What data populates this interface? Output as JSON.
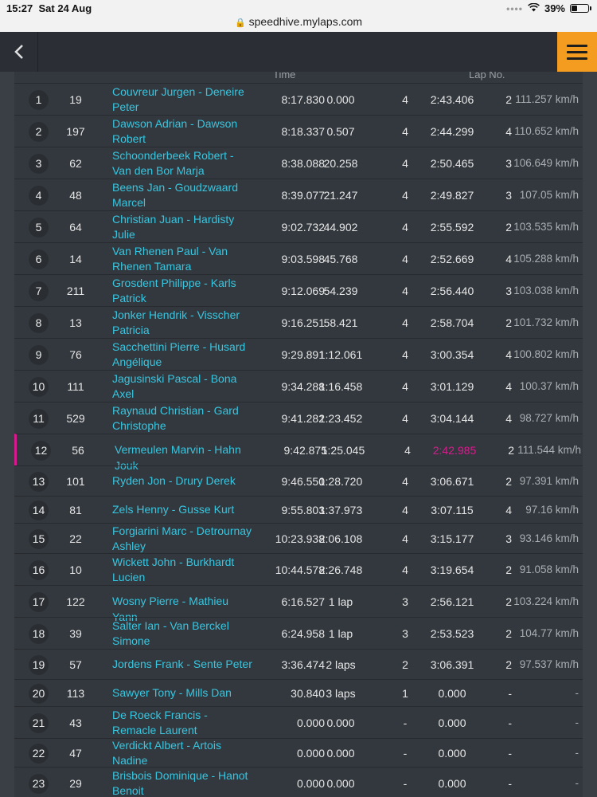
{
  "status_bar": {
    "time": "15:27",
    "date": "Sat 24 Aug",
    "url": "speedhive.mylaps.com",
    "battery": "39%",
    "battery_level": 0.39
  },
  "nav": {
    "back_icon": "chevron-left-icon",
    "menu_icon": "hamburger-menu-icon",
    "menu_color": "#f39c1f"
  },
  "header": {
    "time_label": "Time",
    "lapno_label": "Lap No."
  },
  "colors": {
    "name_link": "#37c6e0",
    "best_lap_highlight": "#d81b8c",
    "background": "#33383e"
  },
  "rows": [
    {
      "pos": "1",
      "num": "19",
      "name": "Couvreur Jurgen - Deneire Peter",
      "time": "8:17.830",
      "gap": "0.000",
      "laps": "4",
      "best": "2:43.406",
      "best_lap": "2",
      "speed": "111.257 km/h"
    },
    {
      "pos": "2",
      "num": "197",
      "name": "Dawson Adrian - Dawson Robert",
      "time": "8:18.337",
      "gap": "0.507",
      "laps": "4",
      "best": "2:44.299",
      "best_lap": "4",
      "speed": "110.652 km/h"
    },
    {
      "pos": "3",
      "num": "62",
      "name": "Schoonderbeek Robert - Van den Bor Marja",
      "time": "8:38.088",
      "gap": "20.258",
      "laps": "4",
      "best": "2:50.465",
      "best_lap": "3",
      "speed": "106.649 km/h"
    },
    {
      "pos": "4",
      "num": "48",
      "name": "Beens Jan - Goudzwaard Marcel",
      "time": "8:39.077",
      "gap": "21.247",
      "laps": "4",
      "best": "2:49.827",
      "best_lap": "3",
      "speed": "107.05 km/h"
    },
    {
      "pos": "5",
      "num": "64",
      "name": "Christian Juan - Hardisty Julie",
      "time": "9:02.732",
      "gap": "44.902",
      "laps": "4",
      "best": "2:55.592",
      "best_lap": "2",
      "speed": "103.535 km/h"
    },
    {
      "pos": "6",
      "num": "14",
      "name": "Van Rhenen Paul - Van Rhenen Tamara",
      "time": "9:03.598",
      "gap": "45.768",
      "laps": "4",
      "best": "2:52.669",
      "best_lap": "4",
      "speed": "105.288 km/h"
    },
    {
      "pos": "7",
      "num": "211",
      "name": "Grosdent Philippe - Karls Patrick",
      "time": "9:12.069",
      "gap": "54.239",
      "laps": "4",
      "best": "2:56.440",
      "best_lap": "3",
      "speed": "103.038 km/h"
    },
    {
      "pos": "8",
      "num": "13",
      "name": "Jonker Hendrik - Visscher Patricia",
      "time": "9:16.251",
      "gap": "58.421",
      "laps": "4",
      "best": "2:58.704",
      "best_lap": "2",
      "speed": "101.732 km/h"
    },
    {
      "pos": "9",
      "num": "76",
      "name": "Sacchettini Pierre - Husard Angélique",
      "time": "9:29.891",
      "gap": "1:12.061",
      "laps": "4",
      "best": "3:00.354",
      "best_lap": "4",
      "speed": "100.802 km/h"
    },
    {
      "pos": "10",
      "num": "111",
      "name": "Jagusinski Pascal - Bona Axel",
      "time": "9:34.288",
      "gap": "1:16.458",
      "laps": "4",
      "best": "3:01.129",
      "best_lap": "4",
      "speed": "100.37 km/h"
    },
    {
      "pos": "11",
      "num": "529",
      "name": "Raynaud Christian - Gard Christophe",
      "time": "9:41.282",
      "gap": "1:23.452",
      "laps": "4",
      "best": "3:04.144",
      "best_lap": "4",
      "speed": "98.727 km/h"
    },
    {
      "pos": "12",
      "num": "56",
      "name": "Vermeulen Marvin - Hahn Jouk",
      "time": "9:42.875",
      "gap": "1:25.045",
      "laps": "4",
      "best": "2:42.985",
      "best_lap": "2",
      "speed": "111.544 km/h",
      "highlight": true
    },
    {
      "pos": "13",
      "num": "101",
      "name": "Ryden Jon - Drury Derek",
      "time": "9:46.550",
      "gap": "1:28.720",
      "laps": "4",
      "best": "3:06.671",
      "best_lap": "2",
      "speed": "97.391 km/h"
    },
    {
      "pos": "14",
      "num": "81",
      "name": "Zels Henny - Gusse Kurt",
      "time": "9:55.803",
      "gap": "1:37.973",
      "laps": "4",
      "best": "3:07.115",
      "best_lap": "4",
      "speed": "97.16 km/h"
    },
    {
      "pos": "15",
      "num": "22",
      "name": "Forgiarini Marc - Detrournay Ashley",
      "time": "10:23.938",
      "gap": "2:06.108",
      "laps": "4",
      "best": "3:15.177",
      "best_lap": "3",
      "speed": "93.146 km/h"
    },
    {
      "pos": "16",
      "num": "10",
      "name": "Wickett John - Burkhardt Lucien",
      "time": "10:44.578",
      "gap": "2:26.748",
      "laps": "4",
      "best": "3:19.654",
      "best_lap": "2",
      "speed": "91.058 km/h"
    },
    {
      "pos": "17",
      "num": "122",
      "name": "Wosny Pierre - Mathieu Yann",
      "time": "6:16.527",
      "gap": "1 lap",
      "laps": "3",
      "best": "2:56.121",
      "best_lap": "2",
      "speed": "103.224 km/h"
    },
    {
      "pos": "18",
      "num": "39",
      "name": "Salter Ian - Van Berckel Simone",
      "time": "6:24.958",
      "gap": "1 lap",
      "laps": "3",
      "best": "2:53.523",
      "best_lap": "2",
      "speed": "104.77 km/h"
    },
    {
      "pos": "19",
      "num": "57",
      "name": "Jordens Frank - Sente Peter",
      "time": "3:36.474",
      "gap": "2 laps",
      "laps": "2",
      "best": "3:06.391",
      "best_lap": "2",
      "speed": "97.537 km/h"
    },
    {
      "pos": "20",
      "num": "113",
      "name": "Sawyer Tony - Mills Dan",
      "time": "30.840",
      "gap": "3 laps",
      "laps": "1",
      "best": "0.000",
      "best_lap": "-",
      "speed": "-"
    },
    {
      "pos": "21",
      "num": "43",
      "name": "De Roeck Francis - Remacle Laurent",
      "time": "0.000",
      "gap": "0.000",
      "laps": "-",
      "best": "0.000",
      "best_lap": "-",
      "speed": "-"
    },
    {
      "pos": "22",
      "num": "47",
      "name": "Verdickt Albert - Artois Nadine",
      "time": "0.000",
      "gap": "0.000",
      "laps": "-",
      "best": "0.000",
      "best_lap": "-",
      "speed": "-"
    },
    {
      "pos": "23",
      "num": "29",
      "name": "Brisbois Dominique - Hanot Benoit",
      "time": "0.000",
      "gap": "0.000",
      "laps": "-",
      "best": "0.000",
      "best_lap": "-",
      "speed": "-"
    }
  ]
}
